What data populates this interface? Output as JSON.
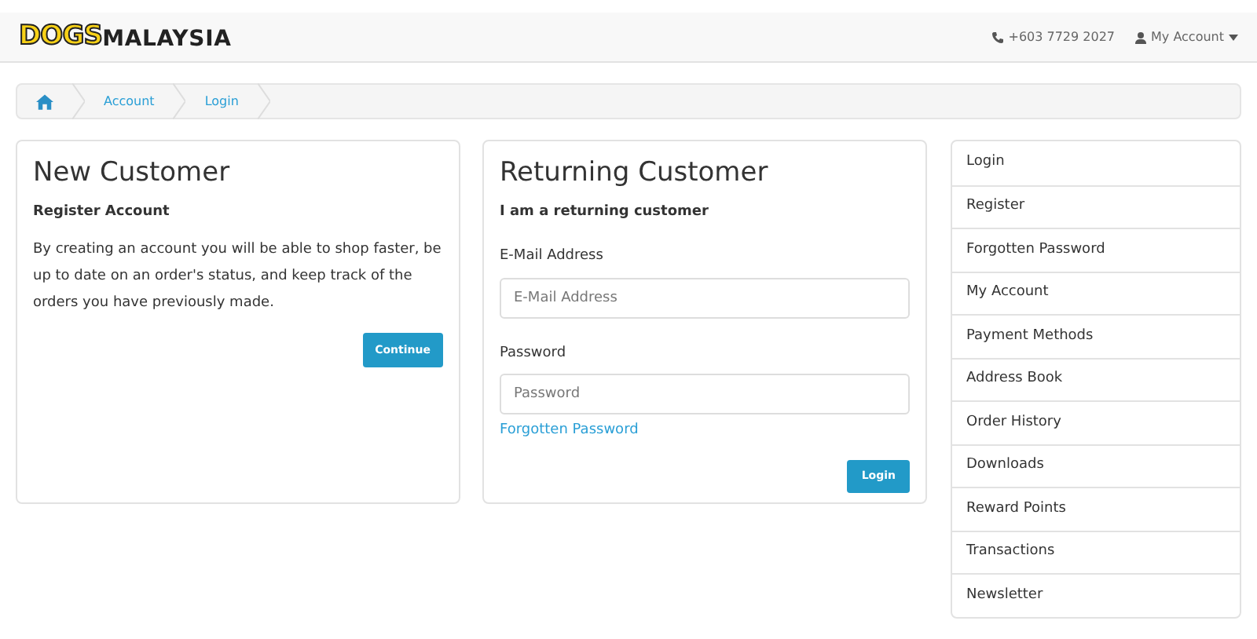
{
  "header": {
    "logo": {
      "part_1": "DOGS",
      "part_2": "MALAYSIA"
    },
    "phone": "+603 7729 2027",
    "account_menu": "My Account"
  },
  "breadcrumb": [
    "Account",
    "Login"
  ],
  "new_customer": {
    "title": "New Customer",
    "subtitle": "Register Account",
    "text": "By creating an account you will be able to shop faster, be up to date on an order's status, and keep track of the orders you have previously made.",
    "button": "Continue"
  },
  "returning_customer": {
    "title": "Returning Customer",
    "subtitle": "I am a returning customer",
    "fields": [
      {
        "label": "E-Mail Address",
        "placeholder": "E-Mail Address"
      },
      {
        "label": "Password",
        "placeholder": "Password"
      }
    ],
    "forgotten_link": "Forgotten Password",
    "button": "Login"
  },
  "sidebar": {
    "items": [
      "Login",
      "Register",
      "Forgotten Password",
      "My Account",
      "Payment Methods",
      "Address Book",
      "Order History",
      "Downloads",
      "Reward Points",
      "Transactions",
      "Newsletter"
    ]
  }
}
